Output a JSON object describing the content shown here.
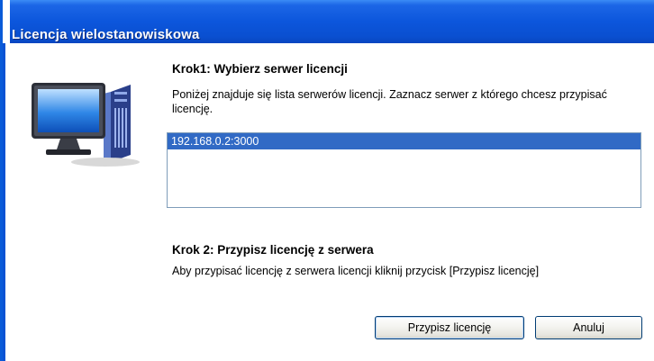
{
  "window": {
    "title": "Licencja wielostanowiskowa"
  },
  "step1": {
    "title": "Krok1: Wybierz serwer licencji",
    "description": "Poniżej znajduje się lista serwerów licencji. Zaznacz serwer z którego chcesz przypisać licencję.",
    "servers": [
      "192.168.0.2:3000"
    ],
    "selected_index": 0
  },
  "step2": {
    "title": "Krok 2: Przypisz licencję z serwera",
    "description": "Aby przypisać licencję z serwera licencji kliknij przycisk [Przypisz licencję]"
  },
  "buttons": {
    "assign_label": "Przypisz licencję",
    "cancel_label": "Anuluj"
  },
  "colors": {
    "titlebar": "#0a56dc",
    "selection": "#316ac5"
  },
  "icons": {
    "computer": "computer-monitor-icon"
  }
}
